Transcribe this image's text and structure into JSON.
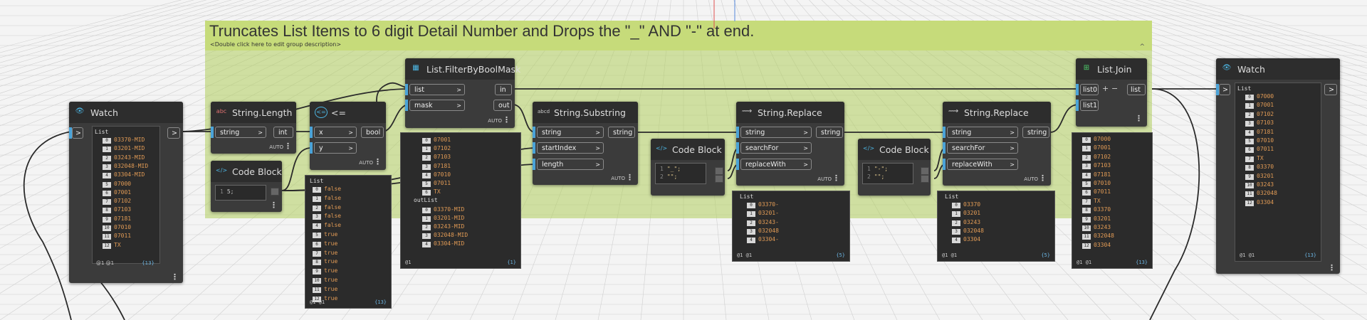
{
  "group": {
    "title": "Truncates List Items to 6 digit Detail Number and Drops the \"_\" AND \"-\" at end.",
    "description": "<Double click here to edit group description>",
    "collapse_glyph": "^",
    "color": "#c6db7a"
  },
  "nodes": {
    "watch1": {
      "title": "Watch",
      "icon": "eye-icon",
      "port_in": ">",
      "port_out": ">",
      "list_header": "List",
      "items": [
        {
          "i": "0",
          "v": "03370-MID"
        },
        {
          "i": "1",
          "v": "03201-MID"
        },
        {
          "i": "2",
          "v": "03243-MID"
        },
        {
          "i": "3",
          "v": "032048-MID"
        },
        {
          "i": "4",
          "v": "03304-MID"
        },
        {
          "i": "5",
          "v": "07000"
        },
        {
          "i": "6",
          "v": "07001"
        },
        {
          "i": "7",
          "v": "07102"
        },
        {
          "i": "8",
          "v": "07103"
        },
        {
          "i": "9",
          "v": "07181"
        },
        {
          "i": "10",
          "v": "07010"
        },
        {
          "i": "11",
          "v": "07011"
        },
        {
          "i": "12",
          "v": "TX"
        }
      ],
      "footer_left": "@1 @1",
      "footer_right": "{13}"
    },
    "strlen": {
      "title": "String.Length",
      "in": "string",
      "out": "int",
      "lacing": "AUTO"
    },
    "cb1": {
      "title": "Code Block",
      "line": "5;",
      "line_no": "1"
    },
    "le": {
      "title": "<=",
      "in1": "x",
      "in2": "y",
      "out": "bool",
      "lacing": "AUTO",
      "list_header": "List",
      "items": [
        {
          "i": "0",
          "v": "false"
        },
        {
          "i": "1",
          "v": "false"
        },
        {
          "i": "2",
          "v": "false"
        },
        {
          "i": "3",
          "v": "false"
        },
        {
          "i": "4",
          "v": "false"
        },
        {
          "i": "5",
          "v": "true"
        },
        {
          "i": "6",
          "v": "true"
        },
        {
          "i": "7",
          "v": "true"
        },
        {
          "i": "8",
          "v": "true"
        },
        {
          "i": "9",
          "v": "true"
        },
        {
          "i": "10",
          "v": "true"
        },
        {
          "i": "11",
          "v": "true"
        },
        {
          "i": "12",
          "v": "true"
        }
      ],
      "footer_left": "@1 @1",
      "footer_right": "{13}"
    },
    "filter": {
      "title": "List.FilterByBoolMask",
      "in1": "list",
      "in2": "mask",
      "out1": "in",
      "out2": "out",
      "lacing": "AUTO",
      "in_items": [
        {
          "i": "0",
          "v": "07001"
        },
        {
          "i": "1",
          "v": "07102"
        },
        {
          "i": "2",
          "v": "07103"
        },
        {
          "i": "3",
          "v": "07181"
        },
        {
          "i": "4",
          "v": "07010"
        },
        {
          "i": "5",
          "v": "07011"
        },
        {
          "i": "6",
          "v": "TX"
        }
      ],
      "out_header": "outList",
      "out_items": [
        {
          "i": "0",
          "v": "03370-MID"
        },
        {
          "i": "1",
          "v": "03201-MID"
        },
        {
          "i": "2",
          "v": "03243-MID"
        },
        {
          "i": "3",
          "v": "032048-MID"
        },
        {
          "i": "4",
          "v": "03304-MID"
        }
      ],
      "footer_left": "@1",
      "footer_right": "{1}"
    },
    "substr": {
      "title": "String.Substring",
      "icon_text": "abcd",
      "in1": "string",
      "in2": "startIndex",
      "in3": "length",
      "out": "string",
      "lacing": "AUTO"
    },
    "cb2": {
      "title": "Code Block",
      "line1": "\"_\";",
      "line2": "\"\";",
      "n1": "1",
      "n2": "2"
    },
    "rep1": {
      "title": "String.Replace",
      "in1": "string",
      "in2": "searchFor",
      "in3": "replaceWith",
      "out": "string",
      "lacing": "AUTO",
      "list_header": "List",
      "items": [
        {
          "i": "0",
          "v": "03370-"
        },
        {
          "i": "1",
          "v": "03201-"
        },
        {
          "i": "2",
          "v": "03243-"
        },
        {
          "i": "3",
          "v": "032048"
        },
        {
          "i": "4",
          "v": "03304-"
        }
      ],
      "footer_left": "@1 @1",
      "footer_right": "{5}"
    },
    "cb3": {
      "title": "Code Block",
      "line1": "\"-\";",
      "line2": "\"\";",
      "n1": "1",
      "n2": "2"
    },
    "rep2": {
      "title": "String.Replace",
      "in1": "string",
      "in2": "searchFor",
      "in3": "replaceWith",
      "out": "string",
      "lacing": "AUTO",
      "list_header": "List",
      "items": [
        {
          "i": "0",
          "v": "03370"
        },
        {
          "i": "1",
          "v": "03201"
        },
        {
          "i": "2",
          "v": "03243"
        },
        {
          "i": "3",
          "v": "032048"
        },
        {
          "i": "4",
          "v": "03304"
        }
      ],
      "footer_left": "@1 @1",
      "footer_right": "{5}"
    },
    "join": {
      "title": "List.Join",
      "in1": "list0",
      "in2": "list1",
      "out": "list",
      "plus": "+",
      "minus": "−",
      "items": [
        {
          "i": "0",
          "v": "07000"
        },
        {
          "i": "1",
          "v": "07001"
        },
        {
          "i": "2",
          "v": "07102"
        },
        {
          "i": "3",
          "v": "07103"
        },
        {
          "i": "4",
          "v": "07181"
        },
        {
          "i": "5",
          "v": "07010"
        },
        {
          "i": "6",
          "v": "07011"
        },
        {
          "i": "7",
          "v": "TX"
        },
        {
          "i": "8",
          "v": "03370"
        },
        {
          "i": "9",
          "v": "03201"
        },
        {
          "i": "10",
          "v": "03243"
        },
        {
          "i": "11",
          "v": "032048"
        },
        {
          "i": "12",
          "v": "03304"
        }
      ],
      "footer_left": "@1 @1",
      "footer_right": "{13}"
    },
    "watch2": {
      "title": "Watch",
      "icon": "eye-icon",
      "port_in": ">",
      "port_out": ">",
      "list_header": "List",
      "items": [
        {
          "i": "0",
          "v": "07000"
        },
        {
          "i": "1",
          "v": "07001"
        },
        {
          "i": "2",
          "v": "07102"
        },
        {
          "i": "3",
          "v": "07103"
        },
        {
          "i": "4",
          "v": "07181"
        },
        {
          "i": "5",
          "v": "07010"
        },
        {
          "i": "6",
          "v": "07011"
        },
        {
          "i": "7",
          "v": "TX"
        },
        {
          "i": "8",
          "v": "03370"
        },
        {
          "i": "9",
          "v": "03201"
        },
        {
          "i": "10",
          "v": "03243"
        },
        {
          "i": "11",
          "v": "032048"
        },
        {
          "i": "12",
          "v": "03304"
        }
      ],
      "footer_left": "@1 @1",
      "footer_right": "{13}"
    }
  },
  "colors": {
    "port_in": "#4aa3d8",
    "node_bg": "#3b3b3b",
    "list_value": "#e09a55"
  }
}
